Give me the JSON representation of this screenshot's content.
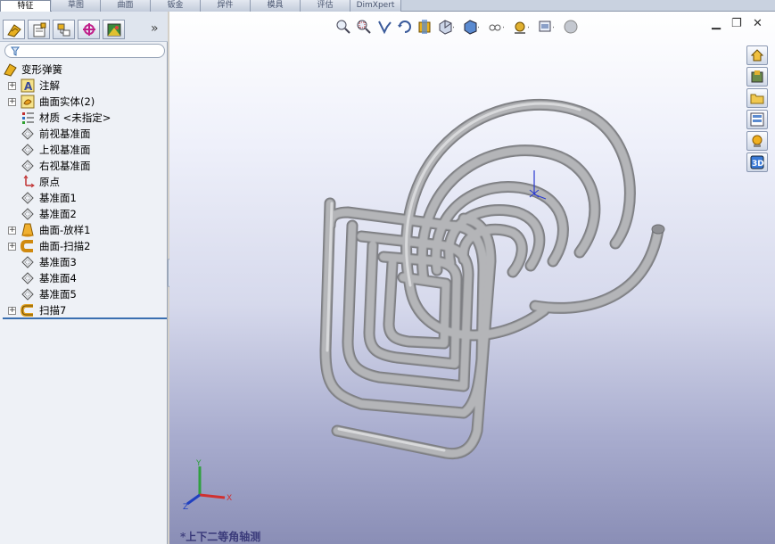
{
  "tabs": [
    {
      "label": "特征",
      "active": true
    },
    {
      "label": "草图"
    },
    {
      "label": "曲面"
    },
    {
      "label": "钣金"
    },
    {
      "label": "焊件"
    },
    {
      "label": "模具"
    },
    {
      "label": "评估"
    },
    {
      "label": "DimXpert"
    }
  ],
  "panel_tabs": [
    "feature-manager-icon",
    "property-manager-icon",
    "configuration-manager-icon",
    "dimxpert-manager-icon",
    "display-manager-icon"
  ],
  "tree": {
    "root": "变形弹簧",
    "items": [
      {
        "label": "注解",
        "icon": "annotation-icon",
        "expandable": true
      },
      {
        "label": "曲面实体(2)",
        "icon": "surface-bodies-icon",
        "expandable": true
      },
      {
        "label": "材质 <未指定>",
        "icon": "material-icon",
        "expandable": false
      },
      {
        "label": "前视基准面",
        "icon": "plane-icon",
        "expandable": false
      },
      {
        "label": "上视基准面",
        "icon": "plane-icon",
        "expandable": false
      },
      {
        "label": "右视基准面",
        "icon": "plane-icon",
        "expandable": false
      },
      {
        "label": "原点",
        "icon": "origin-icon",
        "expandable": false
      },
      {
        "label": "基准面1",
        "icon": "plane-icon",
        "expandable": false
      },
      {
        "label": "基准面2",
        "icon": "plane-icon",
        "expandable": false
      },
      {
        "label": "曲面-放样1",
        "icon": "loft-surface-icon",
        "expandable": true
      },
      {
        "label": "曲面-扫描2",
        "icon": "sweep-surface-icon",
        "expandable": true
      },
      {
        "label": "基准面3",
        "icon": "plane-icon",
        "expandable": false
      },
      {
        "label": "基准面4",
        "icon": "plane-icon",
        "expandable": false
      },
      {
        "label": "基准面5",
        "icon": "plane-icon",
        "expandable": false
      },
      {
        "label": "扫描7",
        "icon": "sweep-icon",
        "expandable": true
      }
    ]
  },
  "view": {
    "orientation_label": "*上下二等角轴测",
    "toolbar": [
      "zoom-to-fit-icon",
      "zoom-to-area-icon",
      "previous-view-icon",
      "rotate-icon",
      "section-view-icon",
      "view-orientation-icon",
      "display-style-icon",
      "hide-show-items-icon",
      "edit-appearance-icon",
      "apply-scene-icon",
      "view-settings-icon"
    ],
    "window_controls": [
      "minimize-icon",
      "restore-icon",
      "close-icon"
    ],
    "task_pane": [
      "home-icon",
      "design-library-icon",
      "file-explorer-icon",
      "view-palette-icon",
      "appearances-icon",
      "3d-content-icon"
    ],
    "triad": {
      "x": "X",
      "y": "Y",
      "z": "Z"
    }
  },
  "colors": {
    "accent": "#3a6fb0",
    "spring": "#a9aaad"
  }
}
